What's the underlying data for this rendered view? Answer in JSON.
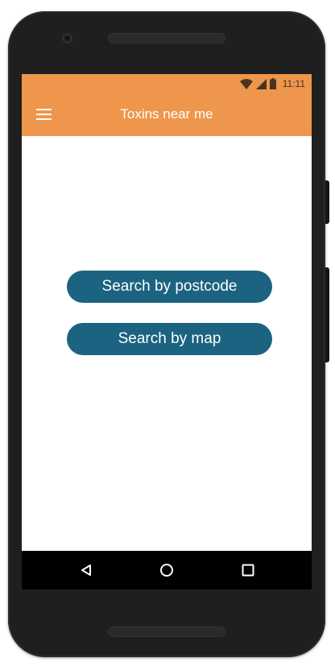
{
  "status_bar": {
    "time": "11:11",
    "icons": [
      "wifi-icon",
      "cell-signal-icon",
      "battery-icon"
    ]
  },
  "app_bar": {
    "title": "Toxins near me",
    "menu_icon": "hamburger-menu-icon"
  },
  "main": {
    "buttons": [
      {
        "label": "Search by postcode"
      },
      {
        "label": "Search by map"
      }
    ]
  },
  "nav_bar": {
    "icons": [
      "back-icon",
      "home-icon",
      "recent-apps-icon"
    ]
  },
  "colors": {
    "app_bar": "#ee964b",
    "button": "#1b6380",
    "button_text": "#ffffff",
    "nav_bar": "#000000"
  }
}
